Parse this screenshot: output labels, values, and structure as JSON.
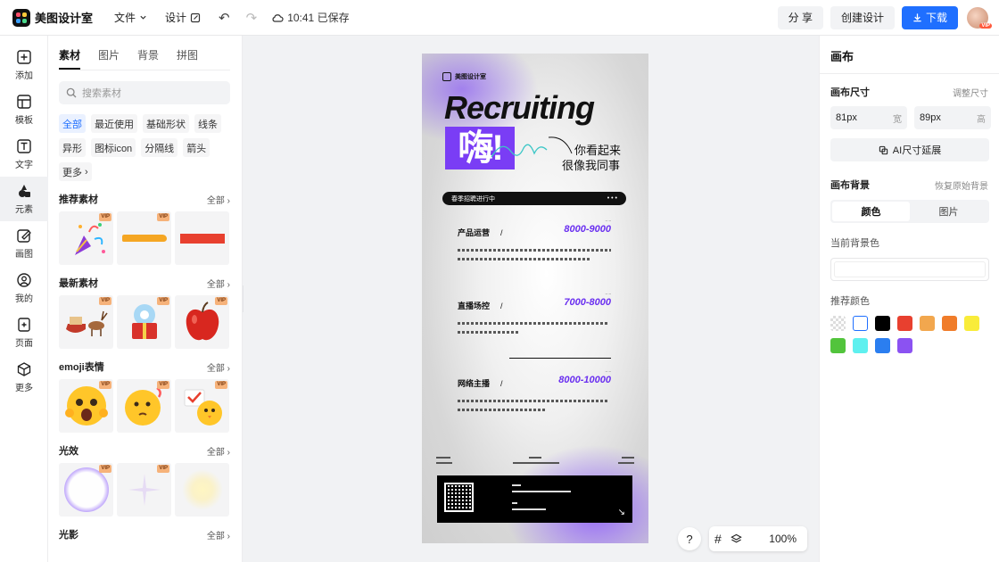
{
  "app": {
    "name": "美图设计室",
    "saved_time": "10:41 已保存"
  },
  "topmenu": {
    "file": "文件",
    "design": "设计"
  },
  "actions": {
    "share": "分 享",
    "create": "创建设计",
    "download": "下载",
    "avatar_badge": "VIP"
  },
  "rail": [
    {
      "label": "添加",
      "icon": "plus-square-icon"
    },
    {
      "label": "模板",
      "icon": "template-icon"
    },
    {
      "label": "文字",
      "icon": "text-icon"
    },
    {
      "label": "元素",
      "icon": "shapes-icon"
    },
    {
      "label": "画图",
      "icon": "draw-icon"
    },
    {
      "label": "我的",
      "icon": "user-icon"
    },
    {
      "label": "页面",
      "icon": "page-icon"
    },
    {
      "label": "更多",
      "icon": "cube-icon"
    }
  ],
  "panel": {
    "tabs": [
      "素材",
      "图片",
      "背景",
      "拼图"
    ],
    "search_placeholder": "搜索素材",
    "tags": [
      "全部",
      "最近使用",
      "基础形状",
      "线条",
      "异形",
      "图标icon",
      "分隔线",
      "箭头",
      "更多"
    ],
    "all_label": "全部",
    "sections": [
      {
        "title": "推荐素材",
        "items": [
          "party-popper",
          "orange-brush-stroke",
          "red-rectangle"
        ]
      },
      {
        "title": "最新素材",
        "items": [
          "reindeer-sleigh",
          "snow-globe-gift",
          "red-apple"
        ]
      },
      {
        "title": "emoji表情",
        "items": [
          "shocked-emoji",
          "thinking-emoji",
          "chick-emoji"
        ]
      },
      {
        "title": "光效",
        "items": [
          "rainbow-bubble",
          "star-sparkle",
          "soft-glow"
        ]
      },
      {
        "title": "光影"
      }
    ],
    "vip": "VIP"
  },
  "poster": {
    "brand": "美图设计室",
    "headline": "Recruiting",
    "hi": "嗨!",
    "tagline_1": "你看起来",
    "tagline_2": "很像我同事",
    "bar_text": "春季招聘进行中",
    "jobs": [
      {
        "title": "产品运营",
        "salary": "8000-9000"
      },
      {
        "title": "直播场控",
        "salary": "7000-8000"
      },
      {
        "title": "网络主播",
        "salary": "8000-10000"
      }
    ]
  },
  "toolbar": {
    "help": "?",
    "zoom": "100%"
  },
  "right": {
    "title": "画布",
    "size_label": "画布尺寸",
    "size_adjust": "调整尺寸",
    "width_value": "81px",
    "width_unit": "宽",
    "height_value": "89px",
    "height_unit": "高",
    "ai_button": "AI尺寸延展",
    "bg_label": "画布背景",
    "bg_reset": "恢复原始背景",
    "seg_color": "颜色",
    "seg_image": "图片",
    "current_bg": "当前背景色",
    "recommended": "推荐颜色",
    "swatches": [
      "#000000",
      "#e8402f",
      "#f2a74e",
      "#f07c2a",
      "#f9ec3a",
      "#52c43c",
      "#5ef0ef",
      "#2b7ef0",
      "#8b52f2"
    ]
  }
}
